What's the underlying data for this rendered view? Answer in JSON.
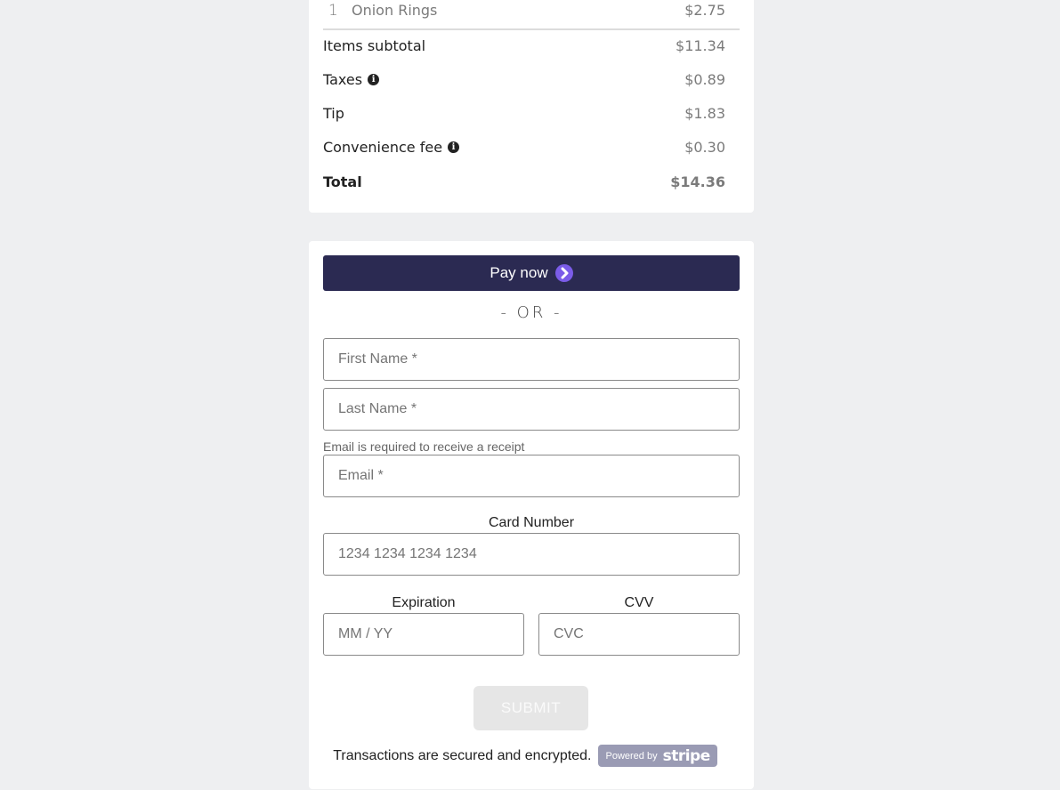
{
  "order": {
    "items": [
      {
        "qty": "1",
        "name": "Onion Rings",
        "price": "$2.75"
      }
    ],
    "summary": {
      "subtotal": {
        "label": "Items subtotal",
        "value": "$11.34"
      },
      "taxes": {
        "label": "Taxes",
        "value": "$0.89",
        "icon": "info-icon"
      },
      "tip": {
        "label": "Tip",
        "value": "$1.83"
      },
      "convenience_fee": {
        "label": "Convenience fee",
        "value": "$0.30",
        "icon": "info-icon"
      },
      "total": {
        "label": "Total",
        "value": "$14.36"
      }
    }
  },
  "payment": {
    "pay_now_label": "Pay now",
    "pay_now_icon": "chevron-right-circle-icon",
    "or_divider": "- OR -",
    "first_name": {
      "placeholder": "First Name *",
      "value": ""
    },
    "last_name": {
      "placeholder": "Last Name *",
      "value": ""
    },
    "email_helper": "Email is required to receive a receipt",
    "email": {
      "placeholder": "Email *",
      "value": ""
    },
    "card_number": {
      "label": "Card Number",
      "placeholder": "1234 1234 1234 1234",
      "value": ""
    },
    "expiration": {
      "label": "Expiration",
      "placeholder": "MM / YY",
      "value": ""
    },
    "cvv": {
      "label": "CVV",
      "placeholder": "CVC",
      "value": ""
    },
    "submit_label": "SUBMIT",
    "secure_text": "Transactions are secured and encrypted.",
    "stripe_badge": {
      "prefix": "Powered by",
      "brand": "stripe"
    }
  },
  "colors": {
    "background": "#eeeff1",
    "pay_now": "#2b2a52",
    "pay_now_icon": "#7b5ce8",
    "submit_disabled": "#e6e6e6",
    "stripe_badge": "#9a9bb4"
  }
}
